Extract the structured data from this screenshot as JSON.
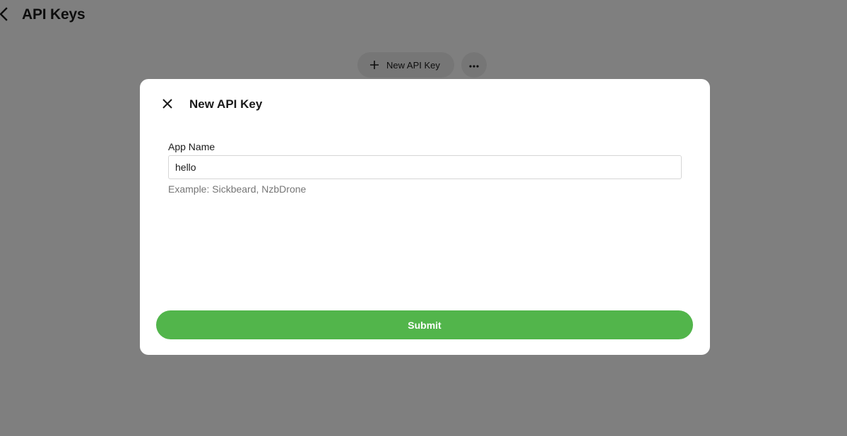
{
  "page": {
    "title": "API Keys",
    "back_icon": "chevron-left-icon"
  },
  "toolbar": {
    "new_key_label": "New API Key",
    "new_key_icon": "plus-icon",
    "more_icon": "more-horizontal-icon"
  },
  "modal": {
    "title": "New API Key",
    "close_icon": "close-icon",
    "field": {
      "label": "App Name",
      "value": "hello",
      "hint": "Example: Sickbeard, NzbDrone"
    },
    "submit_label": "Submit"
  },
  "colors": {
    "accent": "#52b54b",
    "overlay": "rgba(0,0,0,0.5)",
    "button_bg": "#ededed"
  }
}
